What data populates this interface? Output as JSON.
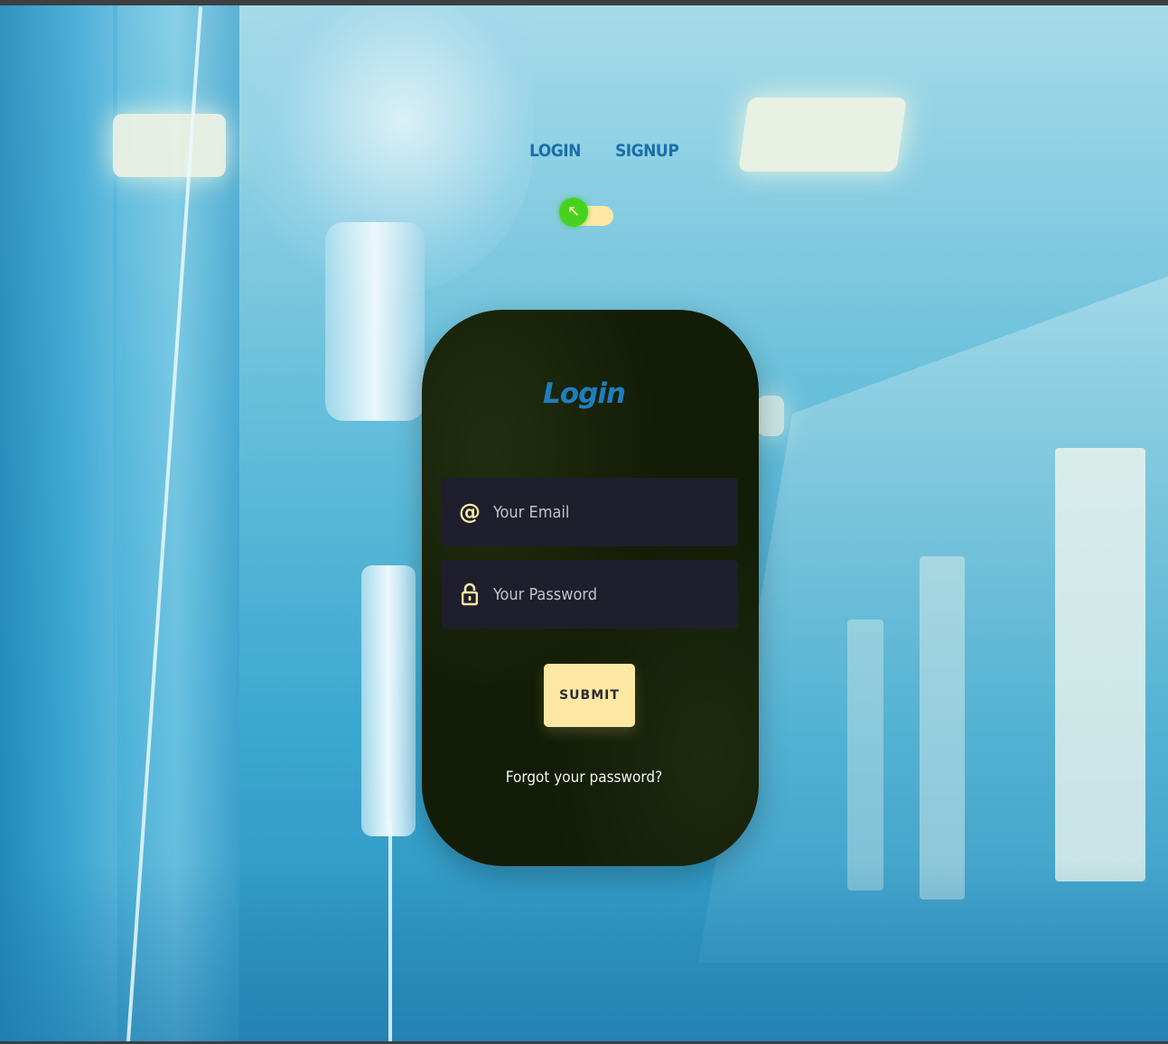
{
  "nav": {
    "login_label": "LOGIN",
    "signup_label": "SIGNUP"
  },
  "toggle": {
    "state": "login",
    "knob_glyph": "↖",
    "knob_color": "#46d320",
    "track_color": "#ffe8a3"
  },
  "card": {
    "title": "Login",
    "email": {
      "icon": "at-icon",
      "icon_glyph": "@",
      "placeholder": "Your Email",
      "value": ""
    },
    "password": {
      "icon": "lock-icon",
      "placeholder": "Your Password",
      "value": ""
    },
    "submit_label": "SUBMIT",
    "forgot_label": "Forgot your password?"
  },
  "colors": {
    "accent": "#ffe8a3",
    "title_blue": "#1d7fc0",
    "card_bg": "#131c06",
    "field_bg": "#1f1e2c"
  }
}
